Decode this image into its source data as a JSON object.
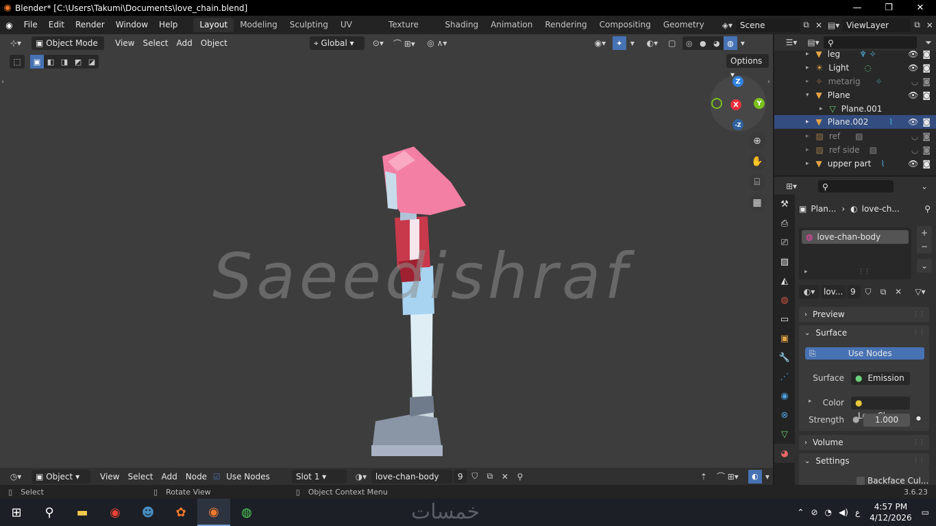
{
  "window": {
    "title": "Blender* [C:\\Users\\Takumi\\Documents\\love_chain.blend]"
  },
  "menu": {
    "file": "File",
    "edit": "Edit",
    "render": "Render",
    "window": "Window",
    "help": "Help"
  },
  "workspaces": [
    "Layout",
    "Modeling",
    "Sculpting",
    "UV Editing",
    "Texture Paint",
    "Shading",
    "Animation",
    "Rendering",
    "Compositing",
    "Geometry Noc"
  ],
  "scene": {
    "name": "Scene",
    "view_layer": "ViewLayer"
  },
  "viewport_header": {
    "mode": "Object Mode",
    "view": "View",
    "select": "Select",
    "add": "Add",
    "object": "Object",
    "orientation": "Global",
    "options": "Options"
  },
  "watermark": "Saeedishraf",
  "outliner": {
    "rows": [
      {
        "name": "leg",
        "icon": "armature"
      },
      {
        "name": "Light",
        "icon": "light"
      },
      {
        "name": "metarig",
        "icon": "armature"
      },
      {
        "name": "Plane",
        "icon": "mesh"
      },
      {
        "name": "Plane.001",
        "icon": "mesh"
      },
      {
        "name": "Plane.002",
        "icon": "mesh",
        "selected": true
      },
      {
        "name": "ref",
        "icon": "image"
      },
      {
        "name": "ref side",
        "icon": "image"
      },
      {
        "name": "upper part",
        "icon": "mesh"
      }
    ]
  },
  "properties": {
    "breadcrumb_obj": "Plan...",
    "breadcrumb_mat": "love-ch...",
    "material_slot": "love-chan-body",
    "material_name": "lov...",
    "users": "9",
    "preview": "Preview",
    "surface_panel": "Surface",
    "use_nodes": "Use Nodes",
    "surface_label": "Surface",
    "surface_value": "Emission",
    "color_label": "Color",
    "color_value": "LoveChan-...",
    "strength_label": "Strength",
    "strength_value": "1.000",
    "volume": "Volume",
    "settings": "Settings",
    "backface": "Backface Cul..."
  },
  "node_header": {
    "mode": "Object",
    "view": "View",
    "select": "Select",
    "add": "Add",
    "node": "Node",
    "use_nodes": "Use Nodes",
    "slot": "Slot 1",
    "material": "love-chan-body",
    "users": "9"
  },
  "status": {
    "select": "Select",
    "rotate": "Rotate View",
    "context": "Object Context Menu",
    "version": "3.6.23"
  },
  "taskbar": {
    "time": "4:57 PM",
    "date": "4/12/2026",
    "lang": "ع",
    "brand": "خمسات"
  },
  "colors": {
    "accent": "#4772b3",
    "selected_row": "#334d80",
    "x_axis": "#e8323f",
    "y_axis": "#7bbf1f",
    "z_axis": "#2f82e0"
  }
}
